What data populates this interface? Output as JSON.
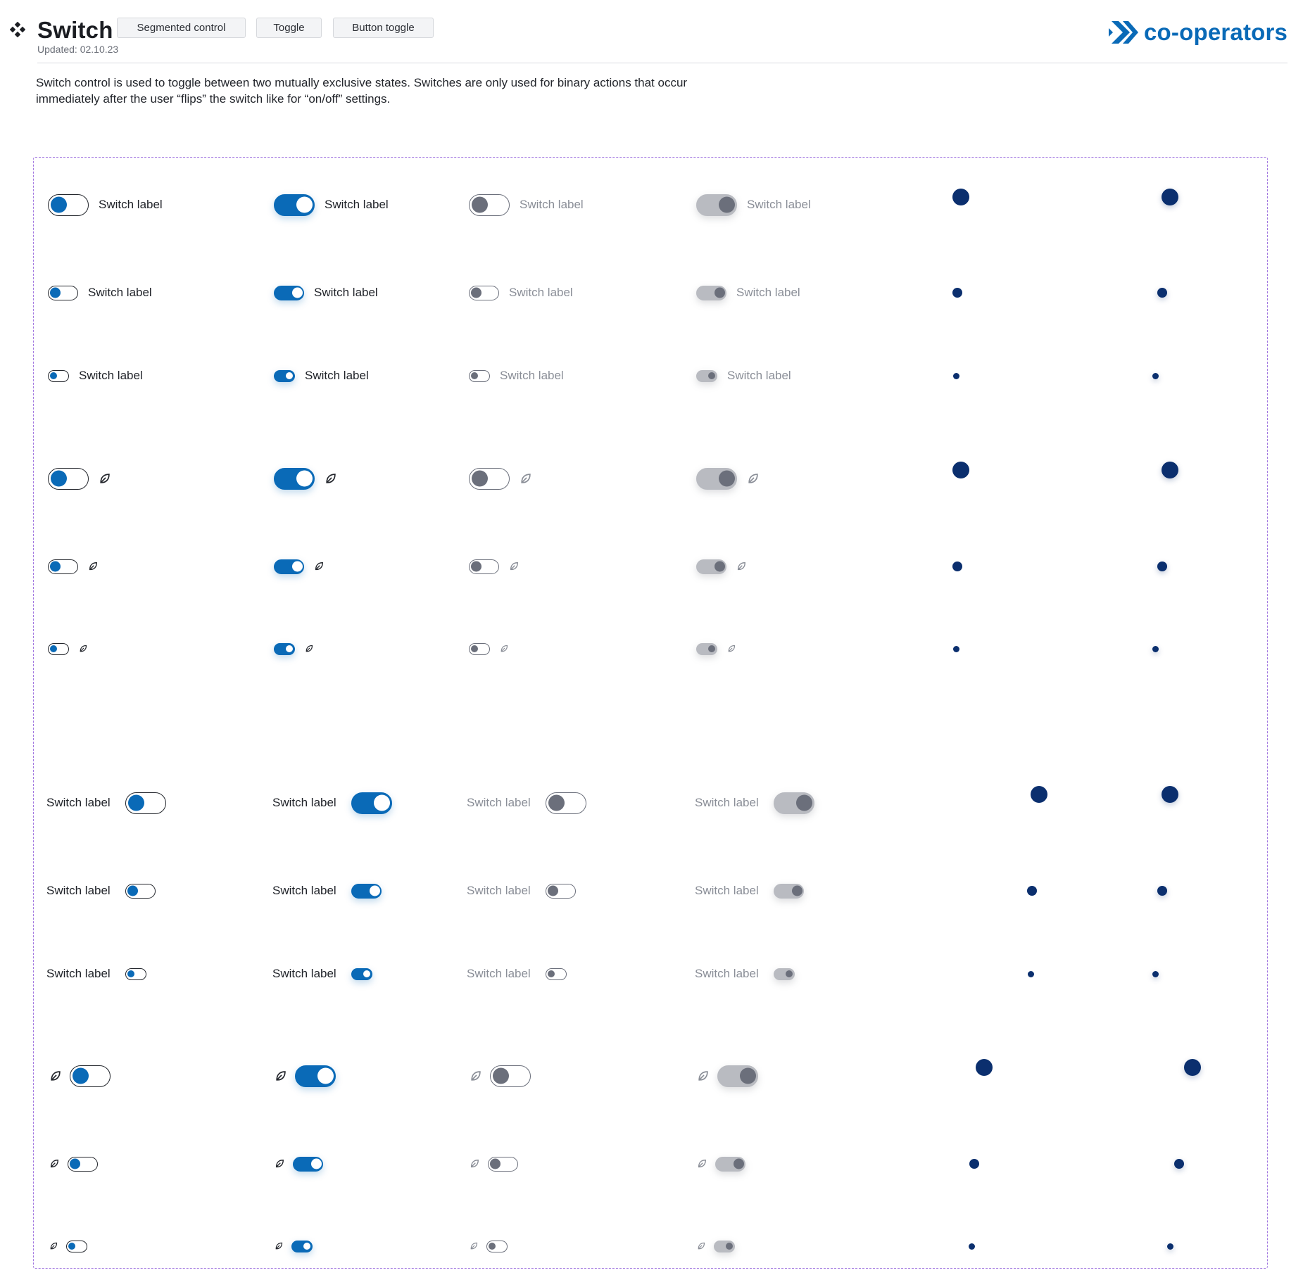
{
  "header": {
    "title": "Switch",
    "updated": "Updated: 02.10.23",
    "tabs": [
      "Segmented control",
      "Toggle",
      "Button toggle"
    ],
    "logo_text": "co-operators",
    "icons": {
      "component": "component-icon",
      "logo": "chevron-logo-icon"
    }
  },
  "description": "Switch control is used to toggle between two mutually exclusive states. Switches are only used for binary actions that occur immediately after the user “flips” the switch like for “on/off” settings.",
  "switch_label": "Switch label",
  "states": [
    "off",
    "on",
    "disabled-off",
    "disabled-on"
  ],
  "sizes": [
    "large",
    "medium",
    "small"
  ],
  "content_icon": "leaf-icon",
  "indicator": "dot",
  "groups": [
    {
      "name": "label-right"
    },
    {
      "name": "icon-right"
    },
    {
      "name": "label-left"
    },
    {
      "name": "icon-left"
    }
  ],
  "colors": {
    "primary": "#0a6ab7",
    "primary_dark": "#0b2f6e",
    "disabled": "#6b6f7b",
    "disabled_track": "#b9bbc1",
    "frame_border": "#a277e0",
    "text": "#1f2228",
    "text_disabled": "#8a8e97"
  }
}
